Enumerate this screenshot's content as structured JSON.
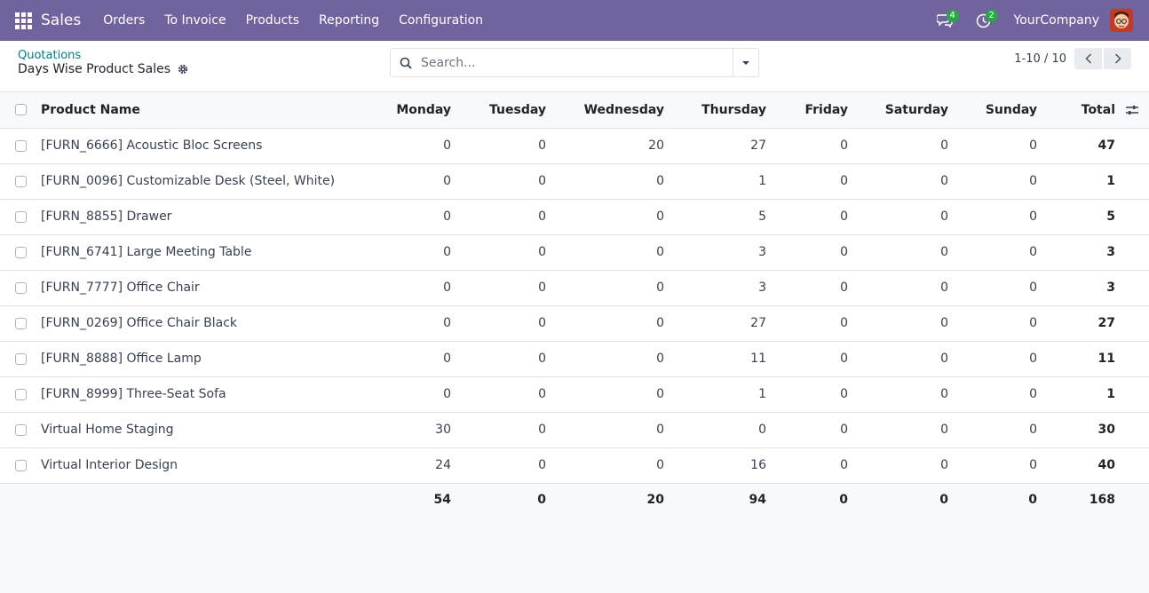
{
  "navbar": {
    "app_name": "Sales",
    "menu": [
      "Orders",
      "To Invoice",
      "Products",
      "Reporting",
      "Configuration"
    ],
    "messages_count": "4",
    "activities_count": "2",
    "company": "YourCompany"
  },
  "control_panel": {
    "breadcrumb": "Quotations",
    "title": "Days Wise Product Sales",
    "search_placeholder": "Search...",
    "pager": "1-10 / 10"
  },
  "table": {
    "columns": [
      "Product Name",
      "Monday",
      "Tuesday",
      "Wednesday",
      "Thursday",
      "Friday",
      "Saturday",
      "Sunday",
      "Total"
    ],
    "rows": [
      {
        "name": "[FURN_6666] Acoustic Bloc Screens",
        "mon": "0",
        "tue": "0",
        "wed": "20",
        "thu": "27",
        "fri": "0",
        "sat": "0",
        "sun": "0",
        "total": "47"
      },
      {
        "name": "[FURN_0096] Customizable Desk (Steel, White)",
        "mon": "0",
        "tue": "0",
        "wed": "0",
        "thu": "1",
        "fri": "0",
        "sat": "0",
        "sun": "0",
        "total": "1"
      },
      {
        "name": "[FURN_8855] Drawer",
        "mon": "0",
        "tue": "0",
        "wed": "0",
        "thu": "5",
        "fri": "0",
        "sat": "0",
        "sun": "0",
        "total": "5"
      },
      {
        "name": "[FURN_6741] Large Meeting Table",
        "mon": "0",
        "tue": "0",
        "wed": "0",
        "thu": "3",
        "fri": "0",
        "sat": "0",
        "sun": "0",
        "total": "3"
      },
      {
        "name": "[FURN_7777] Office Chair",
        "mon": "0",
        "tue": "0",
        "wed": "0",
        "thu": "3",
        "fri": "0",
        "sat": "0",
        "sun": "0",
        "total": "3"
      },
      {
        "name": "[FURN_0269] Office Chair Black",
        "mon": "0",
        "tue": "0",
        "wed": "0",
        "thu": "27",
        "fri": "0",
        "sat": "0",
        "sun": "0",
        "total": "27"
      },
      {
        "name": "[FURN_8888] Office Lamp",
        "mon": "0",
        "tue": "0",
        "wed": "0",
        "thu": "11",
        "fri": "0",
        "sat": "0",
        "sun": "0",
        "total": "11"
      },
      {
        "name": "[FURN_8999] Three-Seat Sofa",
        "mon": "0",
        "tue": "0",
        "wed": "0",
        "thu": "1",
        "fri": "0",
        "sat": "0",
        "sun": "0",
        "total": "1"
      },
      {
        "name": "Virtual Home Staging",
        "mon": "30",
        "tue": "0",
        "wed": "0",
        "thu": "0",
        "fri": "0",
        "sat": "0",
        "sun": "0",
        "total": "30"
      },
      {
        "name": "Virtual Interior Design",
        "mon": "24",
        "tue": "0",
        "wed": "0",
        "thu": "16",
        "fri": "0",
        "sat": "0",
        "sun": "0",
        "total": "40"
      }
    ],
    "totals": {
      "mon": "54",
      "tue": "0",
      "wed": "20",
      "thu": "94",
      "fri": "0",
      "sat": "0",
      "sun": "0",
      "total": "168"
    }
  }
}
